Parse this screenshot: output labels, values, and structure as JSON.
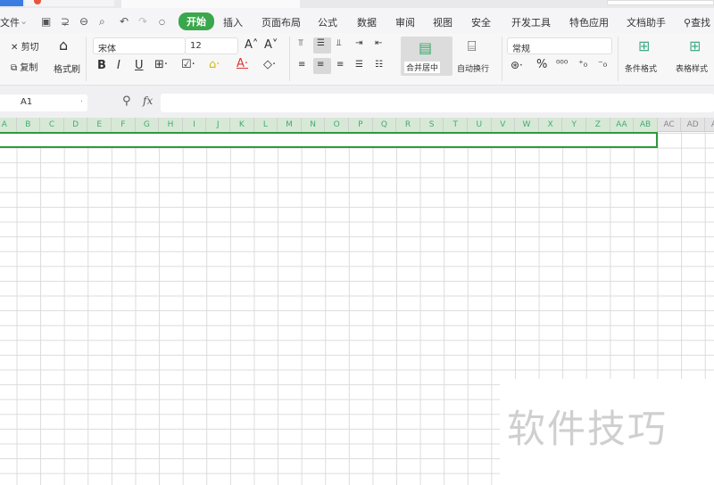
{
  "menu": {
    "file": "文件",
    "tabs": [
      "开始",
      "插入",
      "页面布局",
      "公式",
      "数据",
      "审阅",
      "视图",
      "安全",
      "开发工具",
      "特色应用",
      "文档助手"
    ],
    "search": "查找"
  },
  "ribbon": {
    "cut": "剪切",
    "copy": "复制",
    "format_painter": "格式刷",
    "font": "宋体",
    "size": "12",
    "bold": "B",
    "italic": "I",
    "underline": "U",
    "merge": "合并居中",
    "wrap": "自动换行",
    "number_format": "常规",
    "percent": "%",
    "cond_format": "条件格式",
    "table_style": "表格样式"
  },
  "formula": {
    "name_box": "A1",
    "fx": "fx",
    "value": ""
  },
  "columns": [
    "A",
    "B",
    "C",
    "D",
    "E",
    "F",
    "G",
    "H",
    "I",
    "J",
    "K",
    "L",
    "M",
    "N",
    "O",
    "P",
    "Q",
    "R",
    "S",
    "T",
    "U",
    "V",
    "W",
    "X",
    "Y",
    "Z",
    "AA",
    "AB",
    "AC",
    "AD",
    "AE"
  ],
  "selected_columns": 28,
  "accent": "#3aa74c",
  "watermark": "软件技巧"
}
